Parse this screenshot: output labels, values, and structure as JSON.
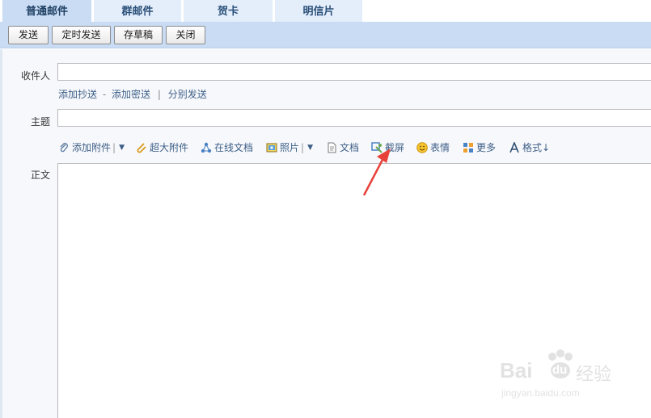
{
  "tabs": [
    {
      "label": "普通邮件",
      "active": true
    },
    {
      "label": "群邮件",
      "active": false
    },
    {
      "label": "贺卡",
      "active": false
    },
    {
      "label": "明信片",
      "active": false
    }
  ],
  "toolbar": {
    "send_label": "发送",
    "scheduled_send_label": "定时发送",
    "save_draft_label": "存草稿",
    "close_label": "关闭"
  },
  "form": {
    "recipient_label": "收件人",
    "recipient_value": "",
    "add_cc_label": "添加抄送",
    "dash": "-",
    "add_bcc_label": "添加密送",
    "pipe": "|",
    "separate_send_label": "分别发送",
    "subject_label": "主题",
    "subject_value": "",
    "body_label": "正文",
    "body_value": ""
  },
  "attach_toolbar": {
    "add_attachment_label": "添加附件",
    "large_attachment_label": "超大附件",
    "online_doc_label": "在线文档",
    "photo_label": "照片",
    "document_label": "文档",
    "screenshot_label": "截屏",
    "emoji_label": "表情",
    "more_label": "更多",
    "format_label": "格式↓"
  },
  "colors": {
    "tab_bg": "#e4eefb",
    "toolbar_bg": "#c9dcf4",
    "link": "#3d5f86",
    "arrow": "#e8413a"
  },
  "watermark": {
    "brand_text": "Bai",
    "brand_text_2": "du",
    "brand_cn": "经验",
    "url": "jingyan.baidu.com"
  }
}
